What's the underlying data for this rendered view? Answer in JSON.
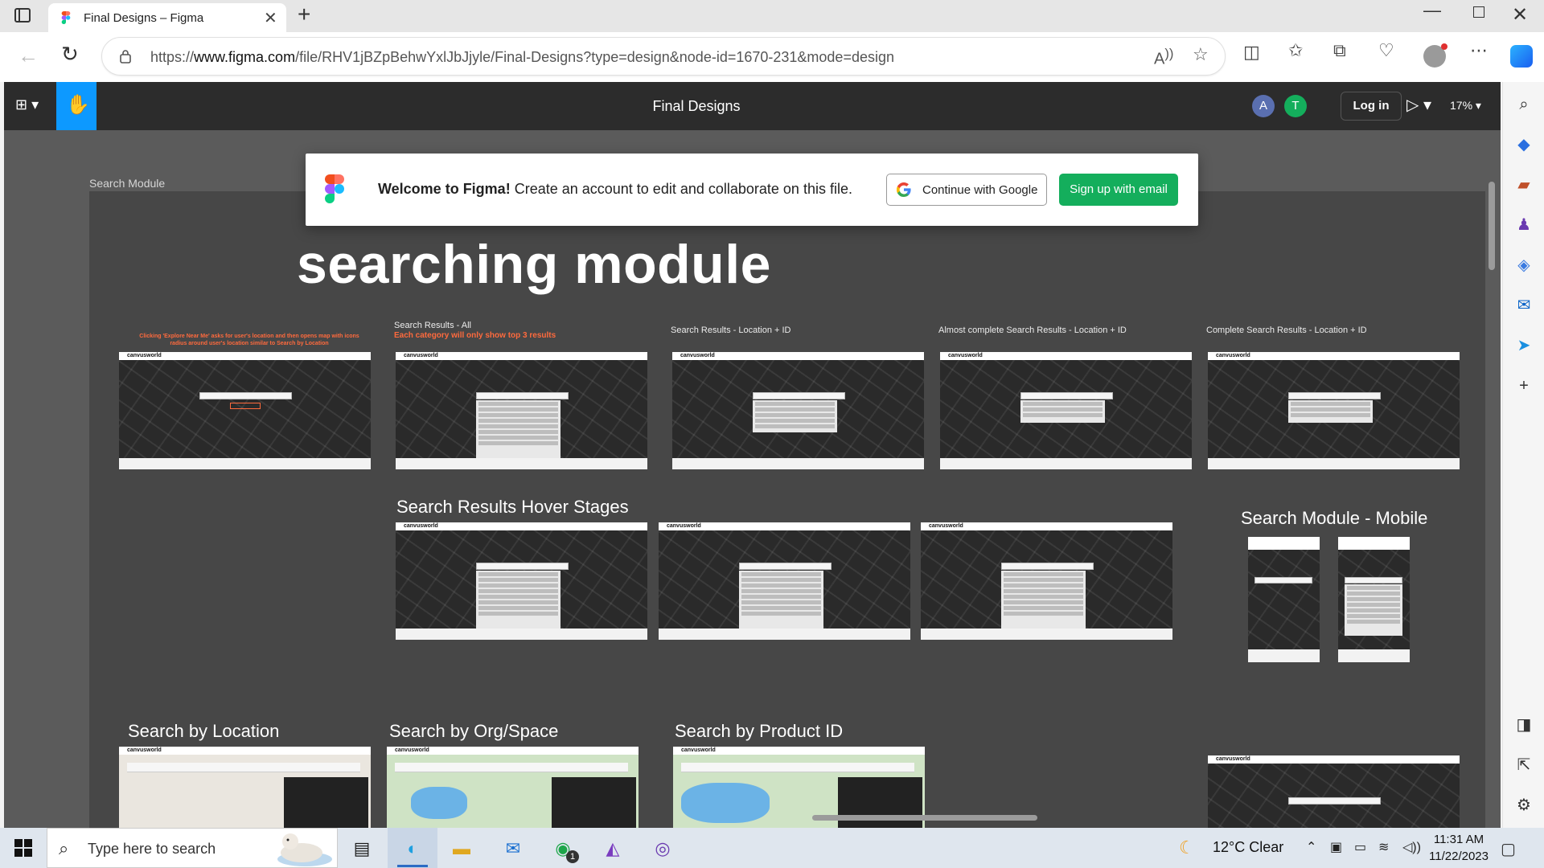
{
  "browser": {
    "tab_title": "Final Designs – Figma",
    "url_prefix": "https://",
    "url_host": "www.figma.com",
    "url_path": "/file/RHV1jBZpBehwYxlJbJjyle/Final-Designs?type=design&node-id=1670-231&mode=design"
  },
  "figma": {
    "file_title": "Final Designs",
    "avatars": [
      "A",
      "T"
    ],
    "avatar_colors": [
      "#5a6fb0",
      "#14ae5c"
    ],
    "login_label": "Log in",
    "zoom": "17%"
  },
  "canvas": {
    "frame_label": "Search Module",
    "big_title": "searching module",
    "red_note_1": "Clicking 'Explore Near Me' asks for user's location and then opens map with icons radius around user's location similar to Search by Location",
    "row1": [
      {
        "label": "",
        "red": ""
      },
      {
        "label": "Search Results - All",
        "red": "Each category will only show top 3 results"
      },
      {
        "label": "Search Results - Location + ID",
        "red": ""
      },
      {
        "label": "Almost complete Search Results - Location + ID",
        "red": ""
      },
      {
        "label": "Complete Search Results - Location + ID",
        "red": ""
      }
    ],
    "hover_label": "Search Results Hover Stages",
    "mobile_label": "Search Module - Mobile",
    "bottom_labels": [
      "Search by Location",
      "Search by Org/Space",
      "Search by Product ID"
    ],
    "thumb_brand": "canvusworld"
  },
  "modal": {
    "welcome_bold": "Welcome to Figma!",
    "welcome_rest": " Create an account to edit and collaborate on this file.",
    "google_label": "Continue with Google",
    "email_label": "Sign up with email",
    "email_color": "#14ae5c"
  },
  "taskbar": {
    "search_placeholder": "Type here to search",
    "weather": "12°C  Clear",
    "time": "11:31 AM",
    "date": "11/22/2023",
    "whatsapp_badge": "1"
  }
}
